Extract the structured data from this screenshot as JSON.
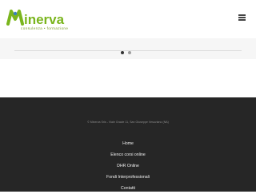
{
  "header": {
    "logo_text": "inerva",
    "logo_tagline": "consulenza • formazione"
  },
  "slider": {
    "dots": 2,
    "active_dot": 1
  },
  "footer": {
    "copyright": "© Minerva Srls - Viale Grazie 11, San Giuseppe Vesuviano (NA)",
    "nav": [
      "Home",
      "Elenco corsi online",
      "DHR Online",
      "Fondi Interprofessionali",
      "Contatti"
    ]
  },
  "colors": {
    "brand_green": "#7ab51d",
    "brand_blue": "#3a7fbf",
    "footer_bg": "#262626"
  }
}
